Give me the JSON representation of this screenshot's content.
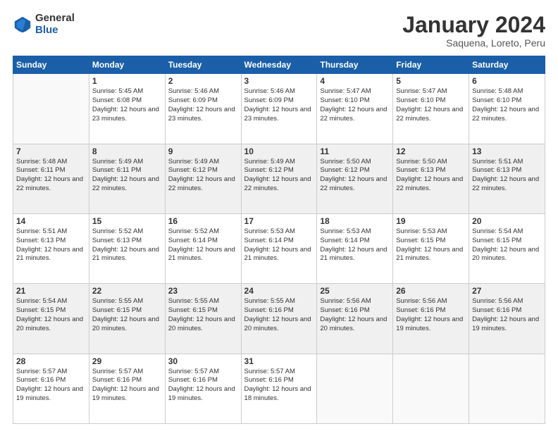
{
  "logo": {
    "general": "General",
    "blue": "Blue"
  },
  "header": {
    "title": "January 2024",
    "subtitle": "Saquena, Loreto, Peru"
  },
  "weekdays": [
    "Sunday",
    "Monday",
    "Tuesday",
    "Wednesday",
    "Thursday",
    "Friday",
    "Saturday"
  ],
  "weeks": [
    [
      {
        "day": "",
        "sunrise": "",
        "sunset": "",
        "daylight": ""
      },
      {
        "day": "1",
        "sunrise": "Sunrise: 5:45 AM",
        "sunset": "Sunset: 6:08 PM",
        "daylight": "Daylight: 12 hours and 23 minutes."
      },
      {
        "day": "2",
        "sunrise": "Sunrise: 5:46 AM",
        "sunset": "Sunset: 6:09 PM",
        "daylight": "Daylight: 12 hours and 23 minutes."
      },
      {
        "day": "3",
        "sunrise": "Sunrise: 5:46 AM",
        "sunset": "Sunset: 6:09 PM",
        "daylight": "Daylight: 12 hours and 23 minutes."
      },
      {
        "day": "4",
        "sunrise": "Sunrise: 5:47 AM",
        "sunset": "Sunset: 6:10 PM",
        "daylight": "Daylight: 12 hours and 22 minutes."
      },
      {
        "day": "5",
        "sunrise": "Sunrise: 5:47 AM",
        "sunset": "Sunset: 6:10 PM",
        "daylight": "Daylight: 12 hours and 22 minutes."
      },
      {
        "day": "6",
        "sunrise": "Sunrise: 5:48 AM",
        "sunset": "Sunset: 6:10 PM",
        "daylight": "Daylight: 12 hours and 22 minutes."
      }
    ],
    [
      {
        "day": "7",
        "sunrise": "Sunrise: 5:48 AM",
        "sunset": "Sunset: 6:11 PM",
        "daylight": "Daylight: 12 hours and 22 minutes."
      },
      {
        "day": "8",
        "sunrise": "Sunrise: 5:49 AM",
        "sunset": "Sunset: 6:11 PM",
        "daylight": "Daylight: 12 hours and 22 minutes."
      },
      {
        "day": "9",
        "sunrise": "Sunrise: 5:49 AM",
        "sunset": "Sunset: 6:12 PM",
        "daylight": "Daylight: 12 hours and 22 minutes."
      },
      {
        "day": "10",
        "sunrise": "Sunrise: 5:49 AM",
        "sunset": "Sunset: 6:12 PM",
        "daylight": "Daylight: 12 hours and 22 minutes."
      },
      {
        "day": "11",
        "sunrise": "Sunrise: 5:50 AM",
        "sunset": "Sunset: 6:12 PM",
        "daylight": "Daylight: 12 hours and 22 minutes."
      },
      {
        "day": "12",
        "sunrise": "Sunrise: 5:50 AM",
        "sunset": "Sunset: 6:13 PM",
        "daylight": "Daylight: 12 hours and 22 minutes."
      },
      {
        "day": "13",
        "sunrise": "Sunrise: 5:51 AM",
        "sunset": "Sunset: 6:13 PM",
        "daylight": "Daylight: 12 hours and 22 minutes."
      }
    ],
    [
      {
        "day": "14",
        "sunrise": "Sunrise: 5:51 AM",
        "sunset": "Sunset: 6:13 PM",
        "daylight": "Daylight: 12 hours and 21 minutes."
      },
      {
        "day": "15",
        "sunrise": "Sunrise: 5:52 AM",
        "sunset": "Sunset: 6:13 PM",
        "daylight": "Daylight: 12 hours and 21 minutes."
      },
      {
        "day": "16",
        "sunrise": "Sunrise: 5:52 AM",
        "sunset": "Sunset: 6:14 PM",
        "daylight": "Daylight: 12 hours and 21 minutes."
      },
      {
        "day": "17",
        "sunrise": "Sunrise: 5:53 AM",
        "sunset": "Sunset: 6:14 PM",
        "daylight": "Daylight: 12 hours and 21 minutes."
      },
      {
        "day": "18",
        "sunrise": "Sunrise: 5:53 AM",
        "sunset": "Sunset: 6:14 PM",
        "daylight": "Daylight: 12 hours and 21 minutes."
      },
      {
        "day": "19",
        "sunrise": "Sunrise: 5:53 AM",
        "sunset": "Sunset: 6:15 PM",
        "daylight": "Daylight: 12 hours and 21 minutes."
      },
      {
        "day": "20",
        "sunrise": "Sunrise: 5:54 AM",
        "sunset": "Sunset: 6:15 PM",
        "daylight": "Daylight: 12 hours and 20 minutes."
      }
    ],
    [
      {
        "day": "21",
        "sunrise": "Sunrise: 5:54 AM",
        "sunset": "Sunset: 6:15 PM",
        "daylight": "Daylight: 12 hours and 20 minutes."
      },
      {
        "day": "22",
        "sunrise": "Sunrise: 5:55 AM",
        "sunset": "Sunset: 6:15 PM",
        "daylight": "Daylight: 12 hours and 20 minutes."
      },
      {
        "day": "23",
        "sunrise": "Sunrise: 5:55 AM",
        "sunset": "Sunset: 6:15 PM",
        "daylight": "Daylight: 12 hours and 20 minutes."
      },
      {
        "day": "24",
        "sunrise": "Sunrise: 5:55 AM",
        "sunset": "Sunset: 6:16 PM",
        "daylight": "Daylight: 12 hours and 20 minutes."
      },
      {
        "day": "25",
        "sunrise": "Sunrise: 5:56 AM",
        "sunset": "Sunset: 6:16 PM",
        "daylight": "Daylight: 12 hours and 20 minutes."
      },
      {
        "day": "26",
        "sunrise": "Sunrise: 5:56 AM",
        "sunset": "Sunset: 6:16 PM",
        "daylight": "Daylight: 12 hours and 19 minutes."
      },
      {
        "day": "27",
        "sunrise": "Sunrise: 5:56 AM",
        "sunset": "Sunset: 6:16 PM",
        "daylight": "Daylight: 12 hours and 19 minutes."
      }
    ],
    [
      {
        "day": "28",
        "sunrise": "Sunrise: 5:57 AM",
        "sunset": "Sunset: 6:16 PM",
        "daylight": "Daylight: 12 hours and 19 minutes."
      },
      {
        "day": "29",
        "sunrise": "Sunrise: 5:57 AM",
        "sunset": "Sunset: 6:16 PM",
        "daylight": "Daylight: 12 hours and 19 minutes."
      },
      {
        "day": "30",
        "sunrise": "Sunrise: 5:57 AM",
        "sunset": "Sunset: 6:16 PM",
        "daylight": "Daylight: 12 hours and 19 minutes."
      },
      {
        "day": "31",
        "sunrise": "Sunrise: 5:57 AM",
        "sunset": "Sunset: 6:16 PM",
        "daylight": "Daylight: 12 hours and 18 minutes."
      },
      {
        "day": "",
        "sunrise": "",
        "sunset": "",
        "daylight": ""
      },
      {
        "day": "",
        "sunrise": "",
        "sunset": "",
        "daylight": ""
      },
      {
        "day": "",
        "sunrise": "",
        "sunset": "",
        "daylight": ""
      }
    ]
  ]
}
